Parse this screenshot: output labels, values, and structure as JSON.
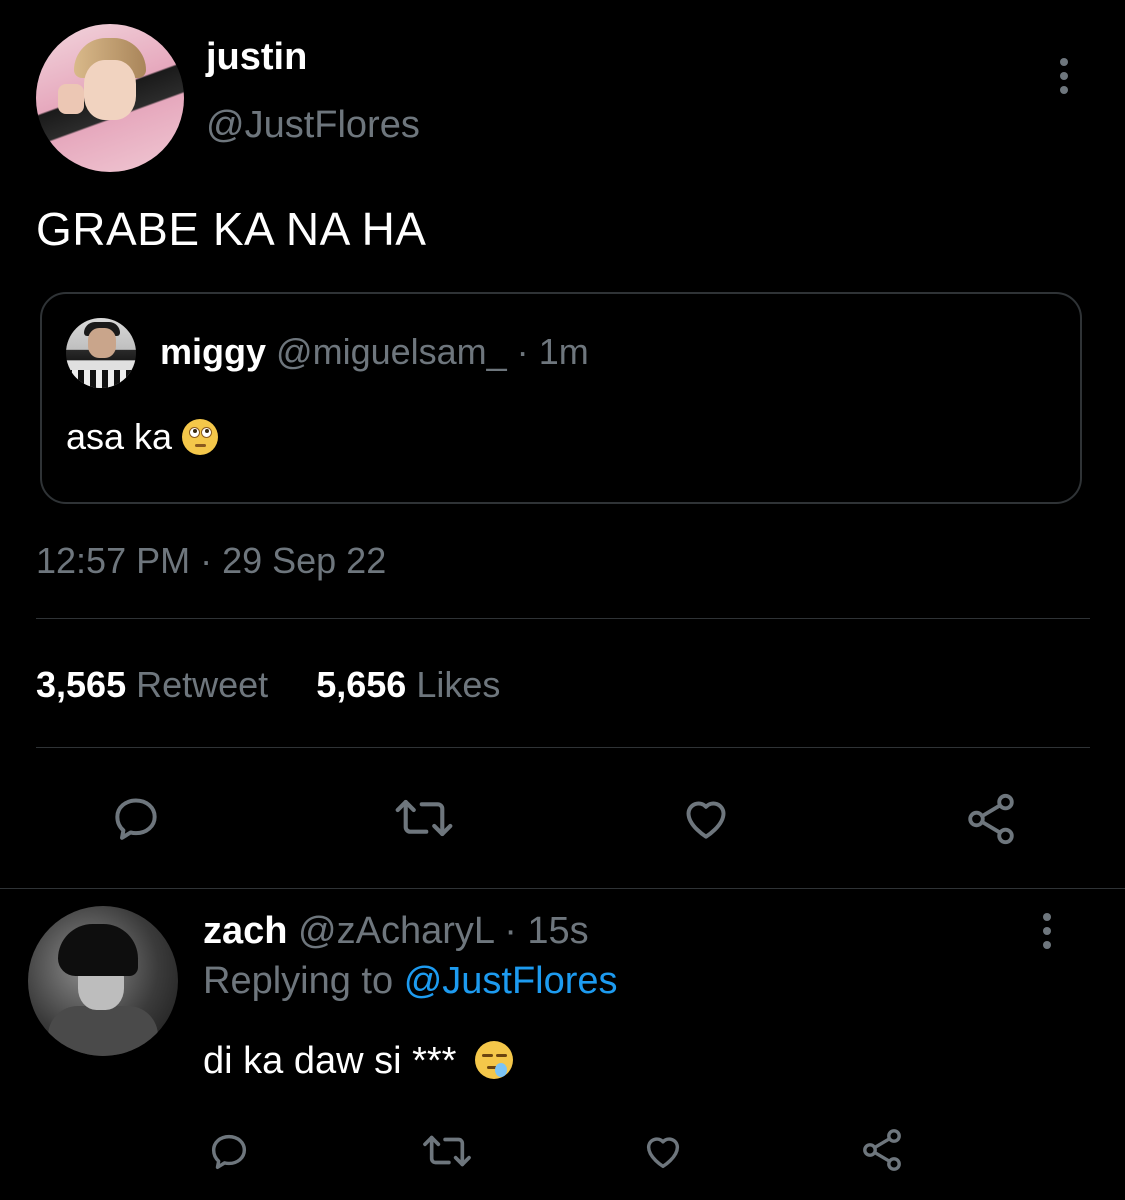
{
  "tweet": {
    "name": "justin",
    "handle": "@JustFlores",
    "text": "GRABE KA NA HA",
    "timestamp": "12:57 PM · 29 Sep 22",
    "more_icon": "more-vertical-icon"
  },
  "quote": {
    "name": "miggy",
    "handle": "@miguelsam_",
    "separator": "·",
    "time": "1m",
    "text": "asa ka",
    "emoji": "face-with-rolling-eyes"
  },
  "stats": {
    "retweets_count": "3,565",
    "retweets_label": "Retweet",
    "likes_count": "5,656",
    "likes_label": "Likes"
  },
  "actions": [
    "reply-icon",
    "retweet-icon",
    "like-icon",
    "share-icon"
  ],
  "reply": {
    "name": "zach",
    "handle": "@zAcharyL",
    "separator": "·",
    "time": "15s",
    "replying_prefix": "Replying to",
    "replying_to": "@JustFlores",
    "text": "di ka daw si ***",
    "emoji": "sleepy-face",
    "more_icon": "more-vertical-icon"
  },
  "colors": {
    "background": "#000000",
    "text": "#ffffff",
    "secondary": "#6e767d",
    "accent": "#1d9bf0",
    "border": "#2f3336"
  }
}
